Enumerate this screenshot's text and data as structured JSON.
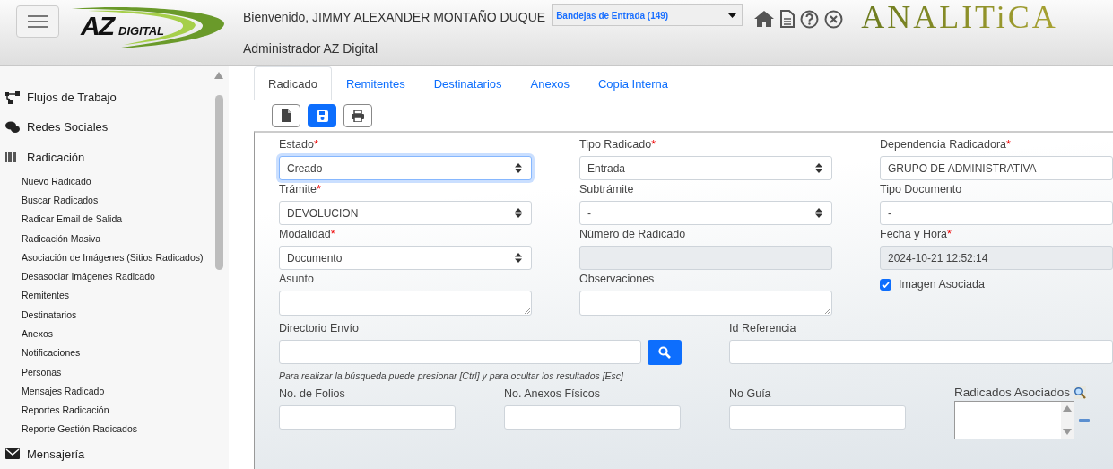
{
  "header": {
    "logo_main": "AZ",
    "logo_sub": "DIGITAL",
    "welcome": "Bienvenido, JIMMY ALEXANDER MONTAÑO DUQUE",
    "role": "Administrador AZ Digital",
    "inbox_select": "Bandejas de Entrada (149)",
    "brand": "ANALITiCA"
  },
  "sidebar": {
    "sections": [
      {
        "label": "Flujos de Trabajo",
        "kind": "flow"
      },
      {
        "label": "Redes Sociales",
        "kind": "chat"
      },
      {
        "label": "Radicación",
        "kind": "barcode",
        "children": [
          "Nuevo Radicado",
          "Buscar Radicados",
          "Radicar Email de Salida",
          "Radicación Masiva",
          "Asociación de Imágenes (Sitios Radicados)",
          "Desasociar Imágenes Radicado",
          "Remitentes",
          "Destinatarios",
          "Anexos",
          "Notificaciones",
          "Personas",
          "Mensajes Radicado",
          "Reportes Radicación",
          "Reporte Gestión Radicados"
        ]
      },
      {
        "label": "Mensajería",
        "kind": "mail"
      }
    ]
  },
  "tabs": [
    {
      "label": "Radicado",
      "selected": true
    },
    {
      "label": "Remitentes",
      "selected": false
    },
    {
      "label": "Destinatarios",
      "selected": false
    },
    {
      "label": "Anexos",
      "selected": false
    },
    {
      "label": "Copia Interna",
      "selected": false
    }
  ],
  "toolbar": [
    {
      "kind": "new",
      "primary": false
    },
    {
      "kind": "save",
      "primary": true
    },
    {
      "kind": "print",
      "primary": false
    }
  ],
  "form": {
    "grid": [
      {
        "label": "Estado",
        "required_mark": "*",
        "kind": "select",
        "value": "Creado",
        "focused": true,
        "disabled": false
      },
      {
        "label": "Tipo Radicado",
        "required_mark": "*",
        "kind": "select",
        "value": "Entrada",
        "focused": false,
        "disabled": false
      },
      {
        "label": "Dependencia Radicadora",
        "required_mark": "*",
        "kind": "input",
        "value": "GRUPO DE ADMINISTRATIVA",
        "focused": false,
        "disabled": false
      },
      {
        "label": "Trámite",
        "required_mark": "*",
        "kind": "select",
        "value": "DEVOLUCION",
        "focused": false,
        "disabled": false
      },
      {
        "label": "Subtrámite",
        "kind": "select",
        "value": "-",
        "focused": false,
        "disabled": false
      },
      {
        "label": "Tipo Documento",
        "kind": "input",
        "value": "-",
        "focused": false,
        "disabled": false
      },
      {
        "label": "Modalidad",
        "required_mark": "*",
        "kind": "select",
        "value": "Documento",
        "focused": false,
        "disabled": false
      },
      {
        "label": "Número de Radicado",
        "kind": "input",
        "focused": false,
        "disabled": true
      },
      {
        "label": "Fecha y Hora",
        "required_mark": "*",
        "kind": "input",
        "value": "2024-10-21 12:52:14",
        "focused": false,
        "disabled": true
      },
      {
        "label": "Asunto",
        "kind": "textarea",
        "focused": false,
        "disabled": false
      },
      {
        "label": "Observaciones",
        "kind": "textarea",
        "focused": false,
        "disabled": false
      },
      {
        "label": "Imagen Asociada",
        "kind": "checkbox",
        "checked": true
      }
    ],
    "directorio": {
      "label": "Directorio Envío",
      "hint": "Para realizar la búsqueda puede presionar [Ctrl] y para ocultar los resultados [Esc]"
    },
    "id_referencia": {
      "label": "Id Referencia"
    },
    "bottom": [
      {
        "label": "No. de Folios"
      },
      {
        "label": "No. Anexos Físicos"
      },
      {
        "label": "No Guía"
      }
    ],
    "radicados_asociados": {
      "label": "Radicados Asociados"
    }
  }
}
